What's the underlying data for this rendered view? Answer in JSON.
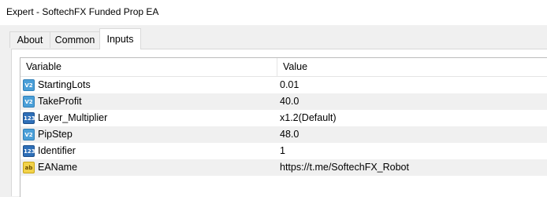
{
  "window": {
    "title": "Expert - SoftechFX Funded Prop EA"
  },
  "tabs": [
    {
      "label": "About"
    },
    {
      "label": "Common"
    },
    {
      "label": "Inputs"
    }
  ],
  "table": {
    "headers": {
      "variable": "Variable",
      "value": "Value"
    },
    "rows": [
      {
        "icon": "real-number-icon",
        "icon_text": "V2",
        "name": "StartingLots",
        "value": "0.01"
      },
      {
        "icon": "real-number-icon",
        "icon_text": "V2",
        "name": "TakeProfit",
        "value": "40.0"
      },
      {
        "icon": "integer-icon",
        "icon_text": "123",
        "name": "Layer_Multiplier",
        "value": "x1.2(Default)"
      },
      {
        "icon": "real-number-icon",
        "icon_text": "V2",
        "name": "PipStep",
        "value": "48.0"
      },
      {
        "icon": "integer-icon",
        "icon_text": "123",
        "name": "Identifier",
        "value": "1"
      },
      {
        "icon": "string-icon",
        "icon_text": "ab",
        "name": "EAName",
        "value": "https://t.me/SoftechFX_Robot"
      }
    ]
  }
}
